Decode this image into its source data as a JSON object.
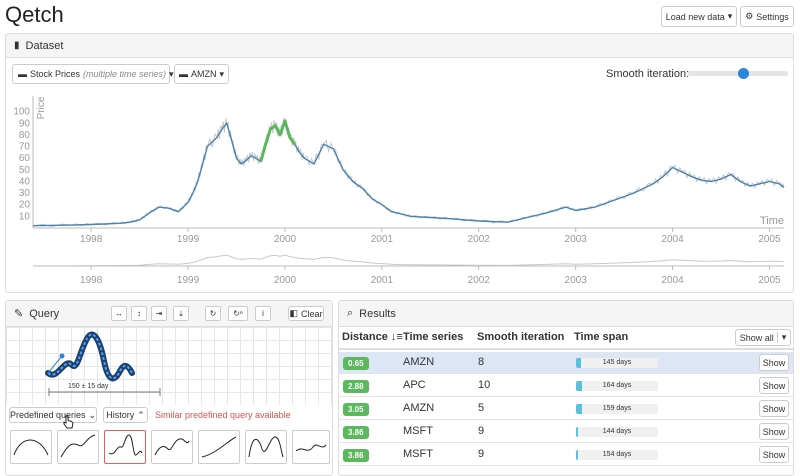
{
  "app": {
    "title": "Qetch"
  },
  "header": {
    "load_label": "Load new data",
    "settings_label": "Settings"
  },
  "dataset": {
    "panel_title": "Dataset",
    "collection_label": "Stock Prices",
    "collection_note": "(multiple time series)",
    "series_label": "AMZN",
    "smooth_label": "Smooth iteration:",
    "smooth_value_fraction": 0.55
  },
  "chart_data": {
    "type": "line",
    "ylabel": "Price",
    "xlabel": "Time",
    "y_ticks": [
      "10",
      "20",
      "30",
      "40",
      "50",
      "60",
      "70",
      "80",
      "90",
      "100"
    ],
    "ylim": [
      0,
      110
    ],
    "x_ticks": [
      "1998",
      "1999",
      "2000",
      "2001",
      "2002",
      "2003",
      "2004",
      "2005"
    ],
    "x": [
      1997.4,
      1997.8,
      1998.0,
      1998.3,
      1998.4,
      1998.5,
      1998.6,
      1998.7,
      1998.8,
      1998.9,
      1999.0,
      1999.05,
      1999.1,
      1999.15,
      1999.2,
      1999.3,
      1999.35,
      1999.4,
      1999.45,
      1999.5,
      1999.55,
      1999.6,
      1999.65,
      1999.7,
      1999.75,
      1999.8,
      1999.85,
      1999.9,
      1999.95,
      2000.0,
      2000.05,
      2000.1,
      2000.15,
      2000.2,
      2000.3,
      2000.4,
      2000.5,
      2000.6,
      2000.7,
      2000.8,
      2000.9,
      2001.0,
      2001.1,
      2001.2,
      2001.3,
      2001.5,
      2001.7,
      2002.0,
      2002.3,
      2002.5,
      2002.7,
      2002.9,
      2003.0,
      2003.2,
      2003.4,
      2003.6,
      2003.8,
      2003.9,
      2004.0,
      2004.1,
      2004.2,
      2004.3,
      2004.4,
      2004.5,
      2004.6,
      2004.7,
      2004.8,
      2004.9,
      2005.0,
      2005.1,
      2005.15
    ],
    "series": [
      {
        "name": "AMZN",
        "color": "#4682b4",
        "values": [
          2,
          2.5,
          3,
          4,
          5,
          7,
          13,
          18,
          17,
          14,
          22,
          30,
          40,
          55,
          70,
          78,
          85,
          90,
          75,
          60,
          55,
          58,
          62,
          60,
          57,
          72,
          85,
          88,
          80,
          92,
          78,
          72,
          65,
          60,
          55,
          72,
          68,
          50,
          40,
          34,
          25,
          20,
          14,
          12,
          10,
          9,
          8,
          6,
          5,
          9,
          13,
          18,
          15,
          18,
          24,
          30,
          38,
          44,
          52,
          48,
          44,
          41,
          40,
          42,
          46,
          40,
          36,
          38,
          40,
          38,
          35
        ]
      },
      {
        "name": "Query match",
        "color": "#5cb85c",
        "values_x": [
          1999.75,
          1999.8,
          1999.85,
          1999.9,
          1999.95,
          2000.0,
          2000.05,
          2000.1
        ],
        "values": [
          57,
          72,
          85,
          88,
          80,
          92,
          78,
          72
        ]
      }
    ]
  },
  "query": {
    "panel_title": "Query",
    "clear_label": "Clear",
    "annotation": "150 ± 15 day",
    "predefined_label": "Predefined queries",
    "history_label": "History",
    "notice": "Similar predefined query available",
    "icons": [
      "stretch-horizontal-icon",
      "stretch-vertical-icon",
      "align-right-icon",
      "align-bottom-icon",
      "undo-icon",
      "regex-icon",
      "info-icon"
    ]
  },
  "results": {
    "panel_title": "Results",
    "columns": [
      "Distance",
      "Time series",
      "Smooth iteration",
      "Time span"
    ],
    "show_all_label": "Show all",
    "show_label": "Show",
    "rows": [
      {
        "distance": "0.65",
        "series": "AMZN",
        "smooth": "8",
        "span": "145 days",
        "fill": 0.06,
        "selected": true
      },
      {
        "distance": "2.88",
        "series": "APC",
        "smooth": "10",
        "span": "164 days",
        "fill": 0.07,
        "selected": false
      },
      {
        "distance": "3.05",
        "series": "AMZN",
        "smooth": "5",
        "span": "159 days",
        "fill": 0.07,
        "selected": false
      },
      {
        "distance": "3.86",
        "series": "MSFT",
        "smooth": "9",
        "span": "144 days",
        "fill": 0.03,
        "selected": false
      },
      {
        "distance": "3.86",
        "series": "MSFT",
        "smooth": "9",
        "span": "154 days",
        "fill": 0.03,
        "selected": false
      }
    ]
  }
}
